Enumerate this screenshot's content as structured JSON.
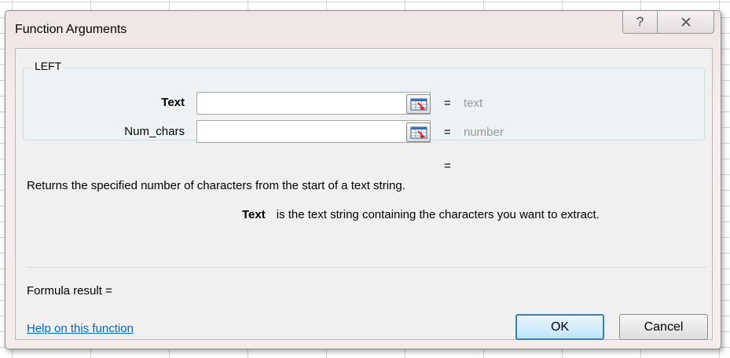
{
  "dialog": {
    "title": "Function Arguments",
    "help_glyph": "?",
    "close_glyph": "☒"
  },
  "group": {
    "function_name": "LEFT",
    "args": [
      {
        "label": "Text",
        "value": "",
        "equals": "=",
        "hint": "text"
      },
      {
        "label": "Num_chars",
        "value": "",
        "equals": "=",
        "hint": "number"
      }
    ],
    "result_equals": "="
  },
  "description": "Returns the specified number of characters from the start of a text string.",
  "arg_help": {
    "name": "Text",
    "text": "is the text string containing the characters you want to extract."
  },
  "formula_result": "Formula result =",
  "help_link": "Help on this function",
  "buttons": {
    "ok": "OK",
    "cancel": "Cancel"
  },
  "icons": {
    "ref": "range-selector-icon"
  }
}
